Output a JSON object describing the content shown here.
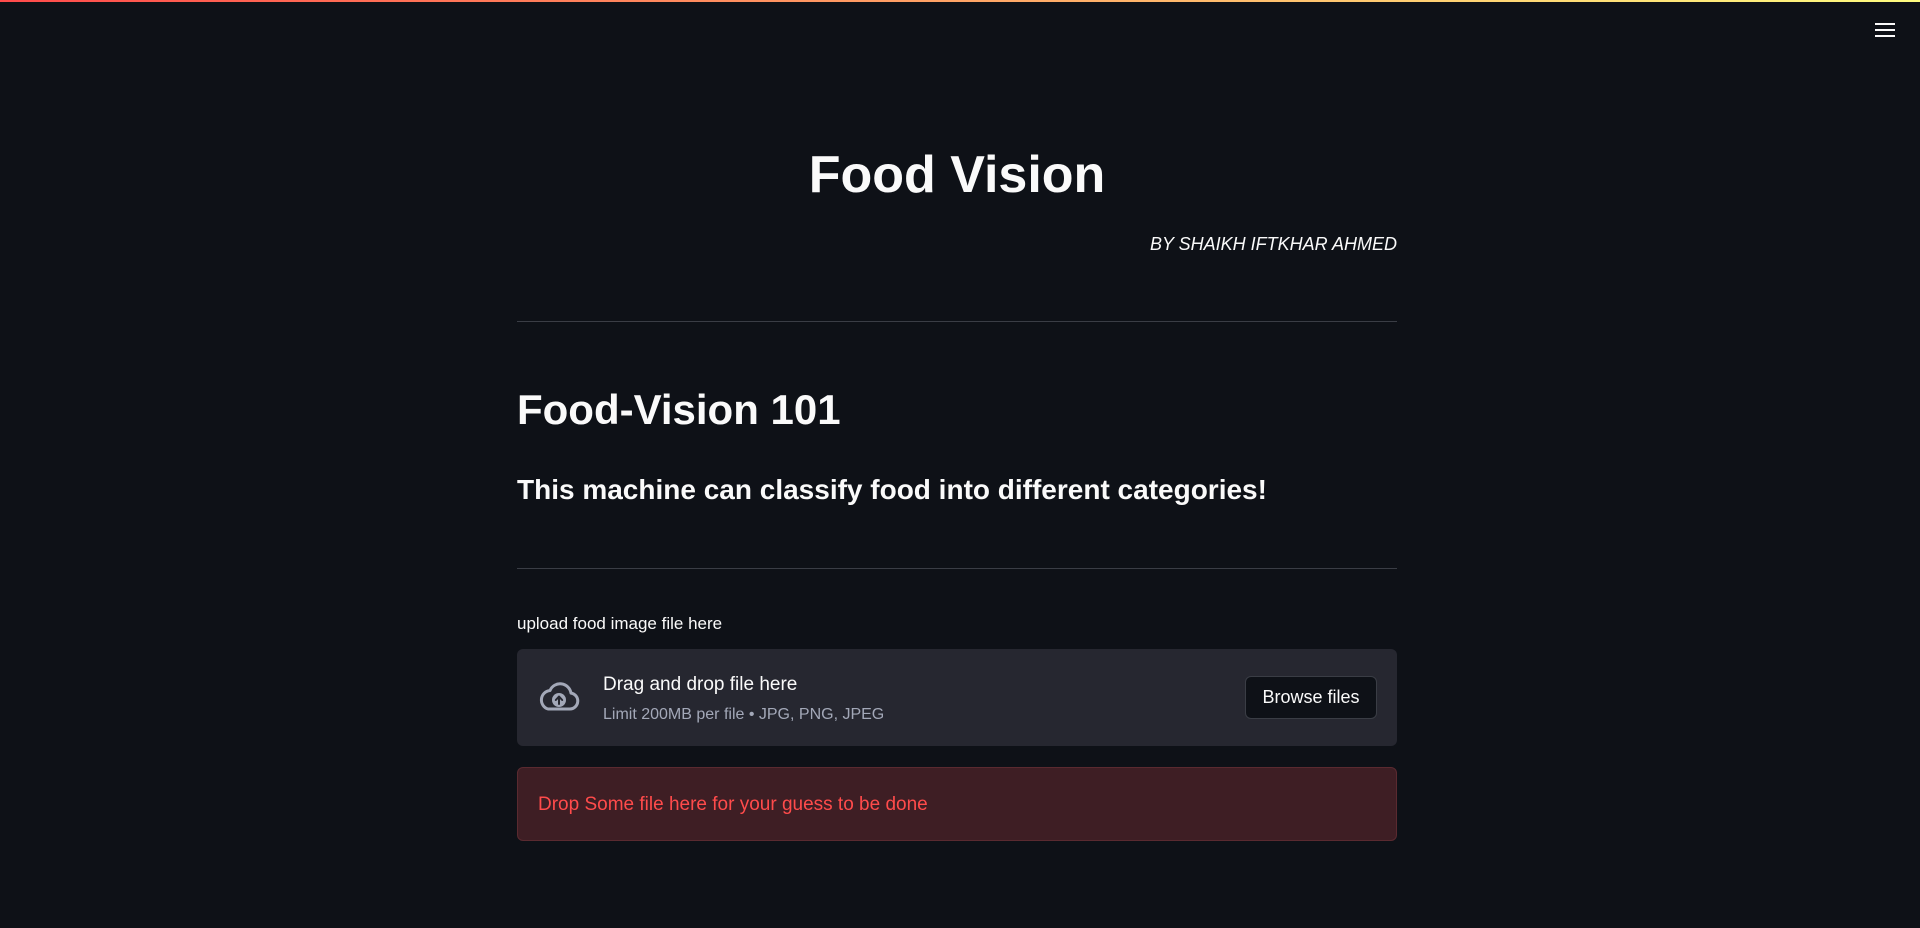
{
  "header": {
    "menu_icon": "hamburger-menu-icon"
  },
  "main": {
    "title": "Food Vision",
    "author": "BY SHAIKH IFTKHAR AHMED",
    "heading": "Food-Vision 101",
    "subheading": "This machine can classify food into different categories!"
  },
  "uploader": {
    "label": "upload food image file here",
    "icon": "cloud-upload-icon",
    "drag_text": "Drag and drop file here",
    "limit_text": "Limit 200MB per file • JPG, PNG, JPEG",
    "browse_label": "Browse files"
  },
  "alert": {
    "message": "Drop Some file here for your guess to be done"
  },
  "colors": {
    "background": "#0e1117",
    "dropzone": "#262730",
    "error_bg": "#3e1e24",
    "error_text": "#ff4b4b"
  }
}
